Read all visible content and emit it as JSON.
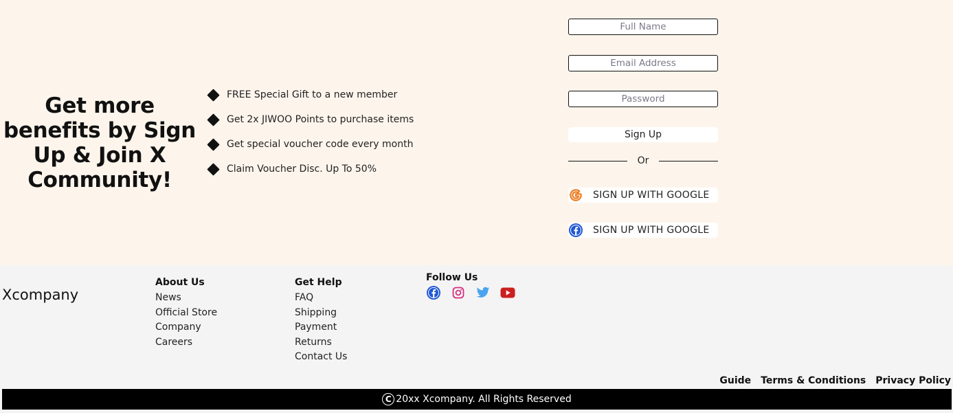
{
  "signup": {
    "headline": "Get more benefits by Sign Up & Join X Community!",
    "benefits": [
      "FREE Special Gift to a new member",
      "Get 2x JIWOO Points to purchase items",
      "Get special voucher code every month",
      "Claim Voucher Disc. Up To 50%"
    ],
    "form": {
      "full_name_placeholder": "Full Name",
      "email_placeholder": "Email Address",
      "password_placeholder": "Password",
      "submit_label": "Sign Up",
      "divider_label": "Or",
      "google_label": "SIGN UP WITH GOOGLE",
      "facebook_label": "SIGN UP WITH GOOGLE"
    }
  },
  "footer": {
    "brand": "Xcompany",
    "about": {
      "title": "About Us",
      "links": [
        "News",
        "Official Store",
        "Company",
        "Careers"
      ]
    },
    "help": {
      "title": "Get Help",
      "links": [
        "FAQ",
        "Shipping",
        "Payment",
        "Returns",
        "Contact Us"
      ]
    },
    "follow": {
      "title": "Follow Us",
      "icons": [
        "facebook-icon",
        "instagram-icon",
        "twitter-icon",
        "youtube-icon"
      ]
    },
    "legal": [
      "Guide",
      "Terms & Conditions",
      "Privacy Policy"
    ],
    "copyright": "20xx Xcompany. All Rights Reserved"
  },
  "colors": {
    "signup_bg": "#fdf5ec",
    "footer_bg": "#f4f4f4",
    "copyright_bg": "#000000",
    "google_orange": "#ef7d22",
    "facebook_blue": "#1f57d6",
    "instagram_pink": "#d62f7f",
    "twitter_blue": "#4aa3f0",
    "youtube_red": "#cc1f1f"
  }
}
